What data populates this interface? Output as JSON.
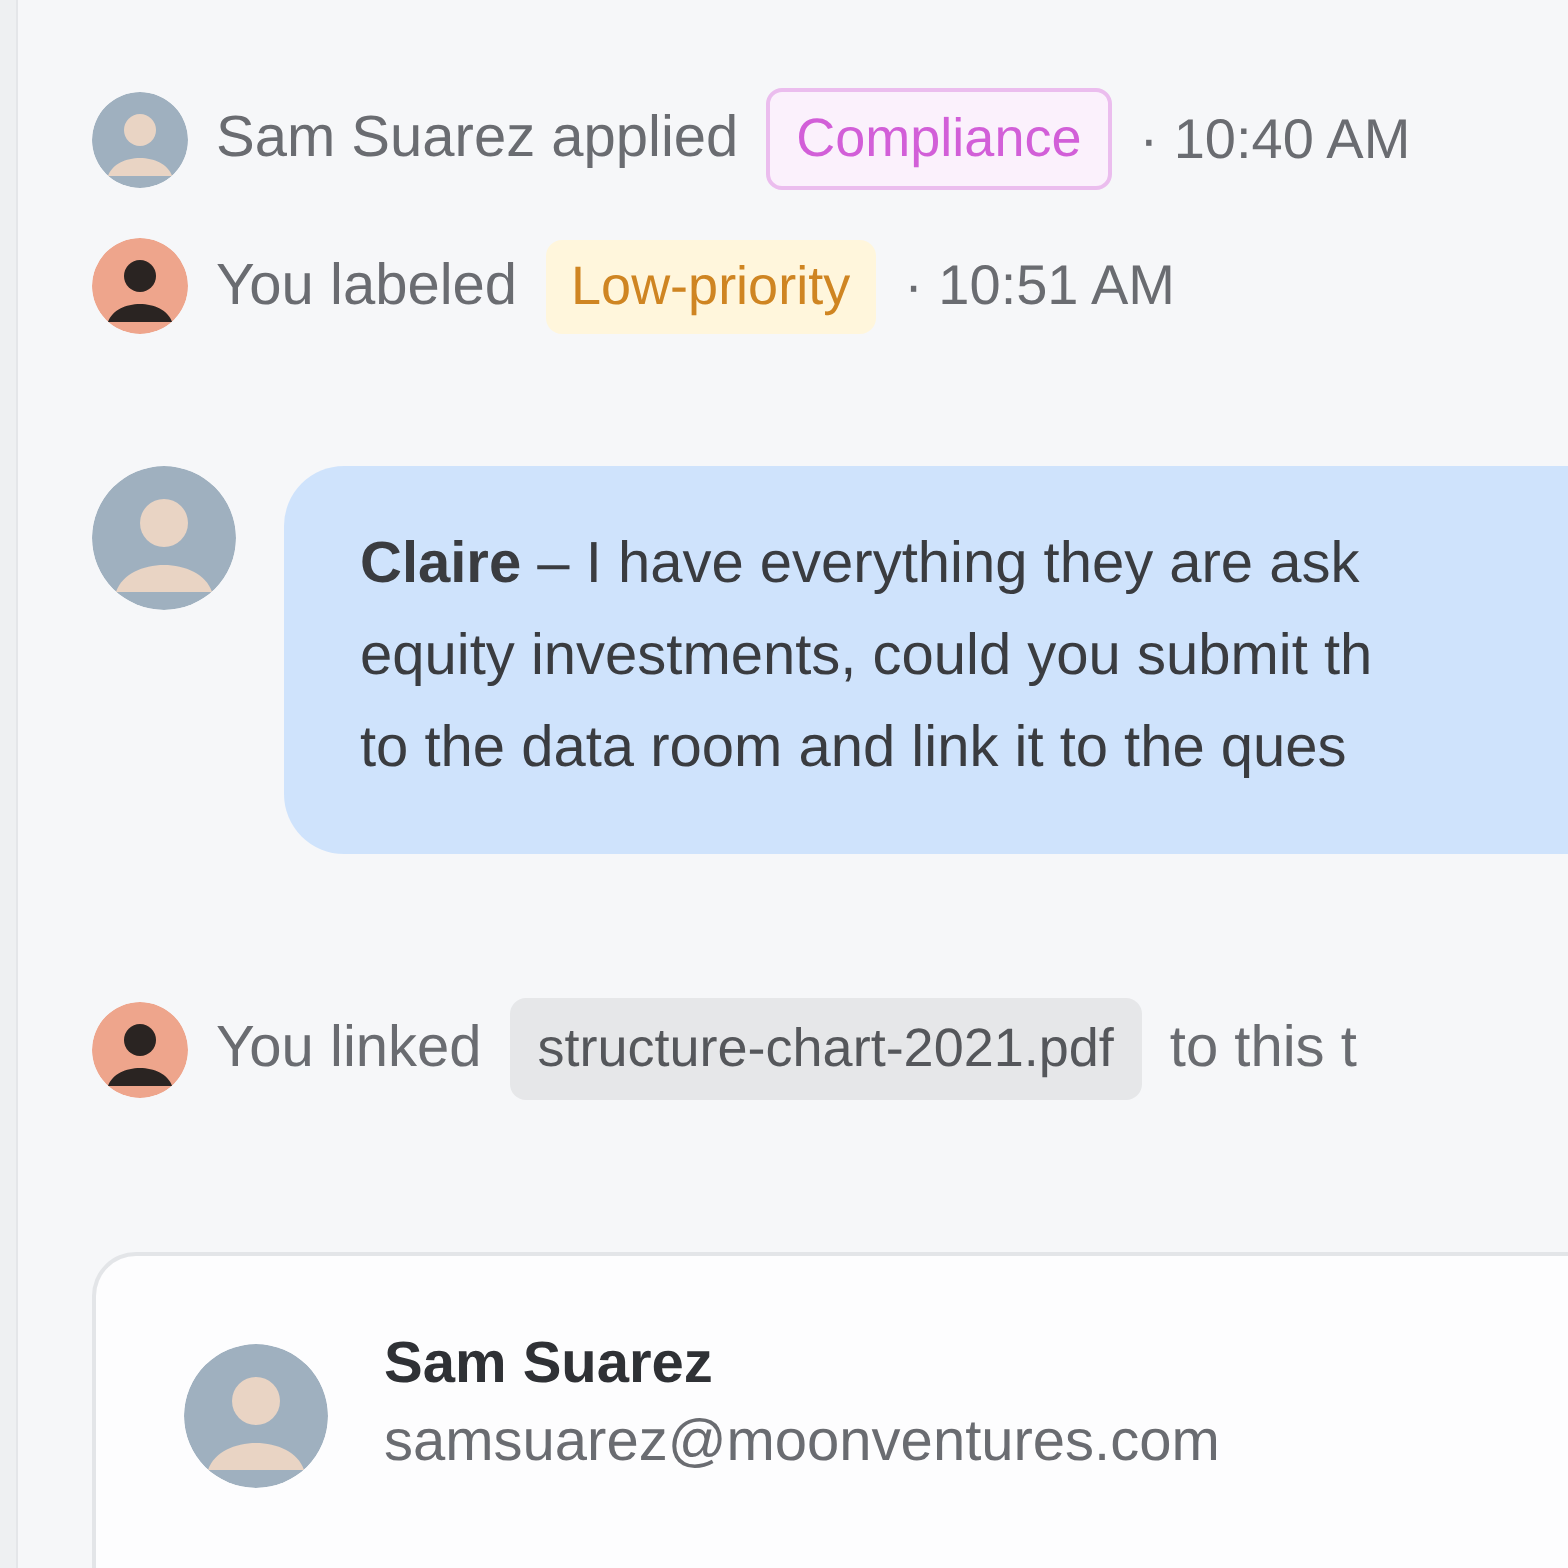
{
  "activity": [
    {
      "kind": "event",
      "actor": "Sam Suarez",
      "avatar": {
        "kind": "light"
      },
      "action": "applied",
      "tag": {
        "label": "Compliance",
        "kind": "compliance"
      },
      "time": "· 10:40 AM"
    },
    {
      "kind": "event",
      "actor": "You",
      "avatar": {
        "kind": "dark"
      },
      "action": "labeled",
      "tag": {
        "label": "Low-priority",
        "kind": "priority"
      },
      "time": "· 10:51 AM"
    },
    {
      "kind": "message",
      "avatar": {
        "kind": "light"
      },
      "lines": [
        "**Claire** – I have everything they are ask",
        "equity investments, could you submit th",
        "to the data room and link it to the ques"
      ]
    },
    {
      "kind": "link",
      "actor": "You",
      "avatar": {
        "kind": "dark"
      },
      "action": "linked",
      "file": "structure-chart-2021.pdf",
      "after": "to this t"
    }
  ],
  "contact_card": {
    "avatar": {
      "kind": "light"
    },
    "name": "Sam Suarez",
    "email": "samsuarez@moonventures.com"
  }
}
